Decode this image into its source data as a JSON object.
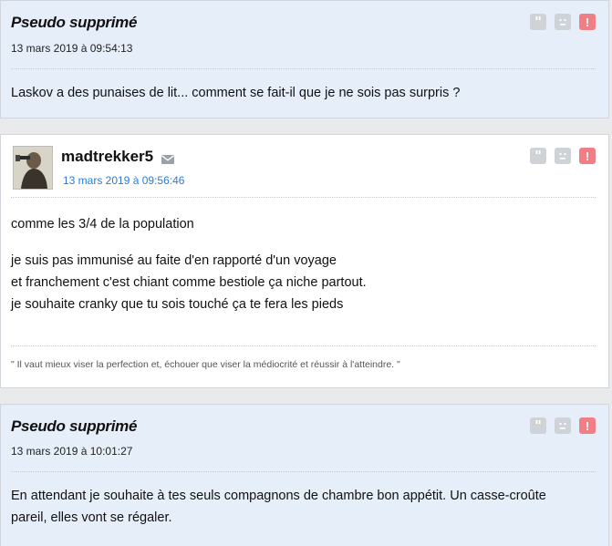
{
  "posts": [
    {
      "author": "Pseudo supprimé",
      "date": "13 mars 2019 à 09:54:13",
      "lines": [
        "Laskov a des punaises de lit... comment se fait-il que je ne sois pas surpris ?"
      ]
    },
    {
      "author": "madtrekker5",
      "date": "13 mars 2019 à 09:56:46",
      "lines": [
        "comme les 3/4 de la population",
        "je suis pas immunisé au faite d'en rapporté d'un voyage",
        "et franchement c'est chiant comme bestiole ça niche partout.",
        "je souhaite cranky que tu sois touché ça te fera les pieds"
      ],
      "signature": "\" Il vaut mieux viser la perfection et, échouer que viser la médiocrité et réussir à l'atteindre. \""
    },
    {
      "author": "Pseudo supprimé",
      "date": "13 mars 2019 à 10:01:27",
      "lines": [
        "En attendant je souhaite à tes seuls compagnons de chambre bon appétit. Un casse-croûte",
        "pareil, elles vont se régaler."
      ]
    }
  ],
  "icons": {
    "quote": "quote-icon",
    "ignore": "sad-face-icon",
    "report": "alert-icon",
    "mail": "envelope-icon"
  },
  "colors": {
    "deleted_bg": "#e6eef9",
    "date_blue": "#2a7bd6",
    "report_red": "#f07f85"
  }
}
